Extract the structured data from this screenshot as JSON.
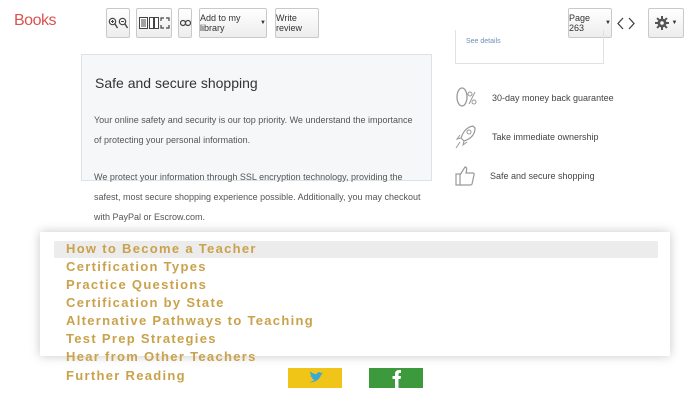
{
  "header": {
    "brand": "Books"
  },
  "toolbar": {
    "add_label": "Add to my library",
    "review_label": "Write review",
    "page_label": "Page 263"
  },
  "card": {
    "title": "Safe and secure shopping",
    "para1": "Your online safety and security is our top priority. We understand the importance of protecting your personal information.",
    "para2": "We protect your information through SSL encryption technology, providing the safest, most secure shopping experience possible. Additionally, you may checkout with PayPal or Escrow.com."
  },
  "rightbox": {
    "text": "See details"
  },
  "features": [
    {
      "icon": "percent-icon",
      "label": "30-day money back guarantee"
    },
    {
      "icon": "rocket-icon",
      "label": "Take immediate ownership"
    },
    {
      "icon": "thumbs-up-icon",
      "label": "Safe and secure shopping"
    }
  ],
  "menu": {
    "items": [
      "How to Become a Teacher",
      "Certification Types",
      "Practice Questions",
      "Certification by State",
      "Alternative Pathways to Teaching",
      "Test Prep Strategies",
      "Hear from Other Teachers",
      "Further Reading"
    ]
  },
  "colors": {
    "brand": "#d9534f",
    "menu_text": "#c9a24b",
    "twitter": "#f1c418",
    "facebook": "#3c9a3c"
  }
}
